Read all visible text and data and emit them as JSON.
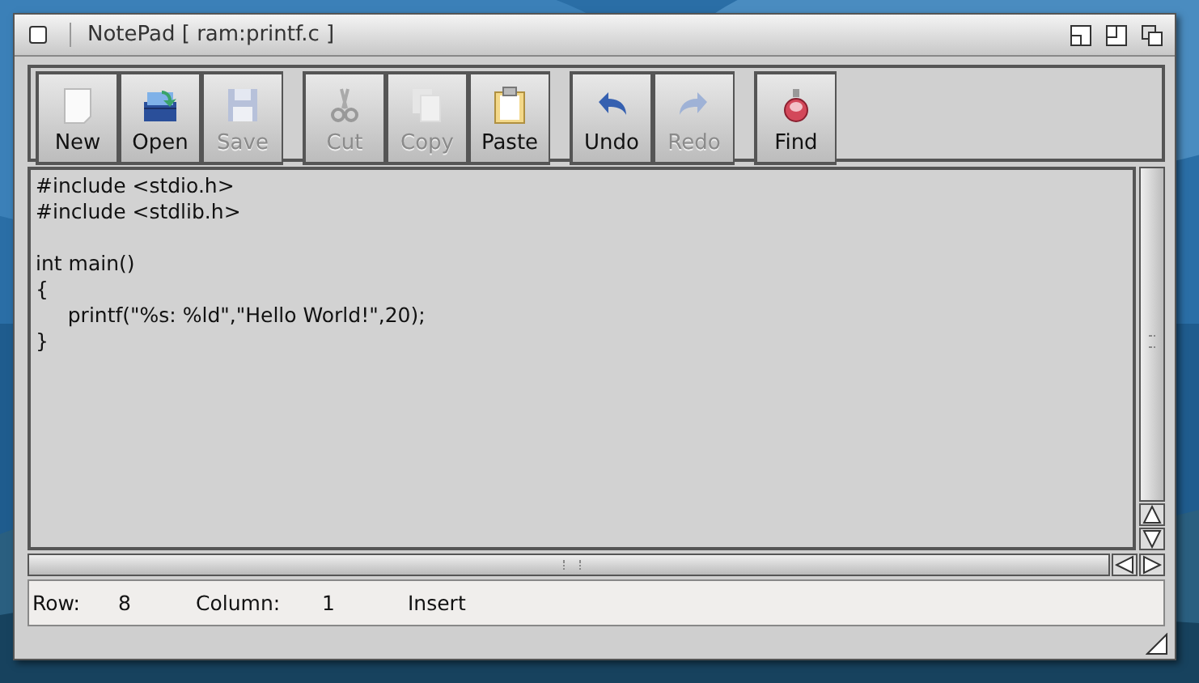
{
  "window": {
    "title": "NotePad [ ram:printf.c ]"
  },
  "toolbar": {
    "groups": [
      [
        {
          "label": "New",
          "kind": "new",
          "disabled": false
        },
        {
          "label": "Open",
          "kind": "open",
          "disabled": false
        },
        {
          "label": "Save",
          "kind": "save",
          "disabled": true
        }
      ],
      [
        {
          "label": "Cut",
          "kind": "cut",
          "disabled": true
        },
        {
          "label": "Copy",
          "kind": "copy",
          "disabled": true
        },
        {
          "label": "Paste",
          "kind": "paste",
          "disabled": false
        }
      ],
      [
        {
          "label": "Undo",
          "kind": "undo",
          "disabled": false
        },
        {
          "label": "Redo",
          "kind": "redo",
          "disabled": true
        }
      ],
      [
        {
          "label": "Find",
          "kind": "find",
          "disabled": false
        }
      ]
    ]
  },
  "editor": {
    "text": "#include <stdio.h>\n#include <stdlib.h>\n\nint main()\n{\n\tprintf(\"%s: %ld\",\"Hello World!\",20);\n}"
  },
  "status_bar": {
    "row_label": "Row:",
    "row": "8",
    "column_label": "Column:",
    "column": "1",
    "mode": "Insert"
  }
}
